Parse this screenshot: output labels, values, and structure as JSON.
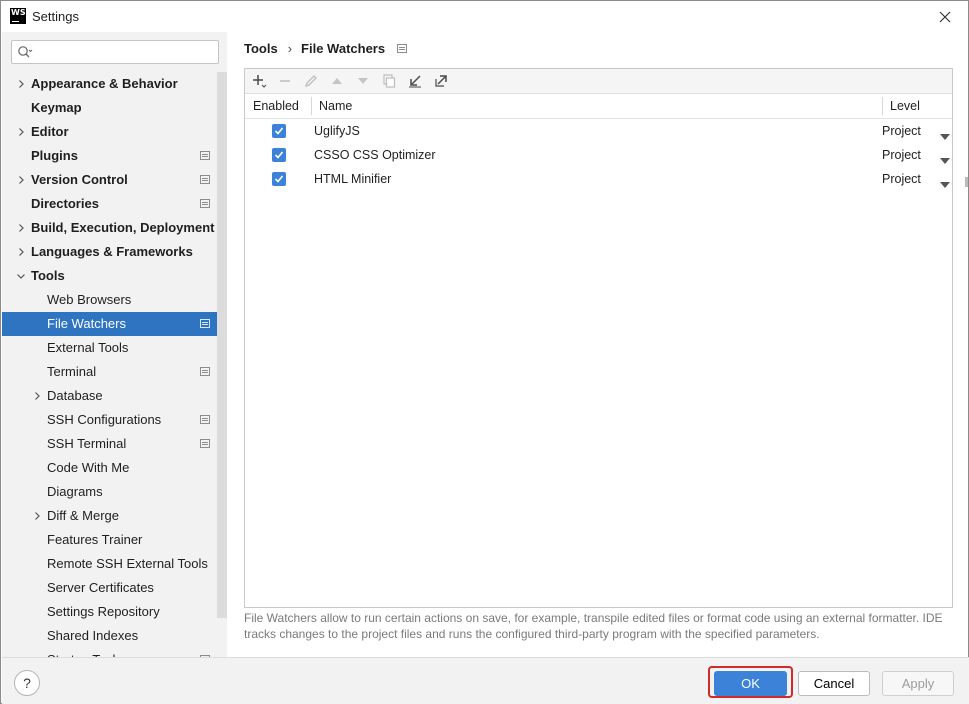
{
  "window": {
    "title": "Settings",
    "logo_text": "WS"
  },
  "search": {
    "value": "",
    "placeholder": ""
  },
  "sidebar": {
    "items": [
      {
        "label": "Appearance & Behavior",
        "level": 0,
        "expandable": true,
        "expanded": false,
        "project": false
      },
      {
        "label": "Keymap",
        "level": 0,
        "expandable": false,
        "project": false
      },
      {
        "label": "Editor",
        "level": 0,
        "expandable": true,
        "expanded": false,
        "project": false
      },
      {
        "label": "Plugins",
        "level": 0,
        "expandable": false,
        "project": true
      },
      {
        "label": "Version Control",
        "level": 0,
        "expandable": true,
        "expanded": false,
        "project": true
      },
      {
        "label": "Directories",
        "level": 0,
        "expandable": false,
        "project": true
      },
      {
        "label": "Build, Execution, Deployment",
        "level": 0,
        "expandable": true,
        "expanded": false,
        "project": false
      },
      {
        "label": "Languages & Frameworks",
        "level": 0,
        "expandable": true,
        "expanded": false,
        "project": false
      },
      {
        "label": "Tools",
        "level": 0,
        "expandable": true,
        "expanded": true,
        "project": false
      },
      {
        "label": "Web Browsers",
        "level": 1,
        "expandable": false,
        "project": false
      },
      {
        "label": "File Watchers",
        "level": 1,
        "expandable": false,
        "project": true,
        "selected": true
      },
      {
        "label": "External Tools",
        "level": 1,
        "expandable": false,
        "project": false
      },
      {
        "label": "Terminal",
        "level": 1,
        "expandable": false,
        "project": true
      },
      {
        "label": "Database",
        "level": 1,
        "expandable": true,
        "expanded": false,
        "project": false
      },
      {
        "label": "SSH Configurations",
        "level": 1,
        "expandable": false,
        "project": true
      },
      {
        "label": "SSH Terminal",
        "level": 1,
        "expandable": false,
        "project": true
      },
      {
        "label": "Code With Me",
        "level": 1,
        "expandable": false,
        "project": false
      },
      {
        "label": "Diagrams",
        "level": 1,
        "expandable": false,
        "project": false
      },
      {
        "label": "Diff & Merge",
        "level": 1,
        "expandable": true,
        "expanded": false,
        "project": false
      },
      {
        "label": "Features Trainer",
        "level": 1,
        "expandable": false,
        "project": false
      },
      {
        "label": "Remote SSH External Tools",
        "level": 1,
        "expandable": false,
        "project": false
      },
      {
        "label": "Server Certificates",
        "level": 1,
        "expandable": false,
        "project": false
      },
      {
        "label": "Settings Repository",
        "level": 1,
        "expandable": false,
        "project": false
      },
      {
        "label": "Shared Indexes",
        "level": 1,
        "expandable": false,
        "project": false
      },
      {
        "label": "Startup Tasks",
        "level": 1,
        "expandable": false,
        "project": true
      }
    ]
  },
  "breadcrumb": {
    "parent": "Tools",
    "separator": "›",
    "current": "File Watchers"
  },
  "table": {
    "columns": {
      "enabled": "Enabled",
      "name": "Name",
      "level": "Level"
    },
    "rows": [
      {
        "enabled": true,
        "name": "UglifyJS",
        "level": "Project"
      },
      {
        "enabled": true,
        "name": "CSSO CSS Optimizer",
        "level": "Project"
      },
      {
        "enabled": true,
        "name": "HTML Minifier",
        "level": "Project"
      }
    ]
  },
  "description": "File Watchers allow to run certain actions on save, for example, transpile edited files or format code using an external formatter. IDE tracks changes to the project files and runs the configured third-party program with the specified parameters.",
  "footer": {
    "help_label": "?",
    "ok_label": "OK",
    "cancel_label": "Cancel",
    "apply_label": "Apply"
  },
  "colors": {
    "accent": "#2f74c0",
    "button_primary": "#3b82d8",
    "highlight_ring": "#d22a2a"
  }
}
